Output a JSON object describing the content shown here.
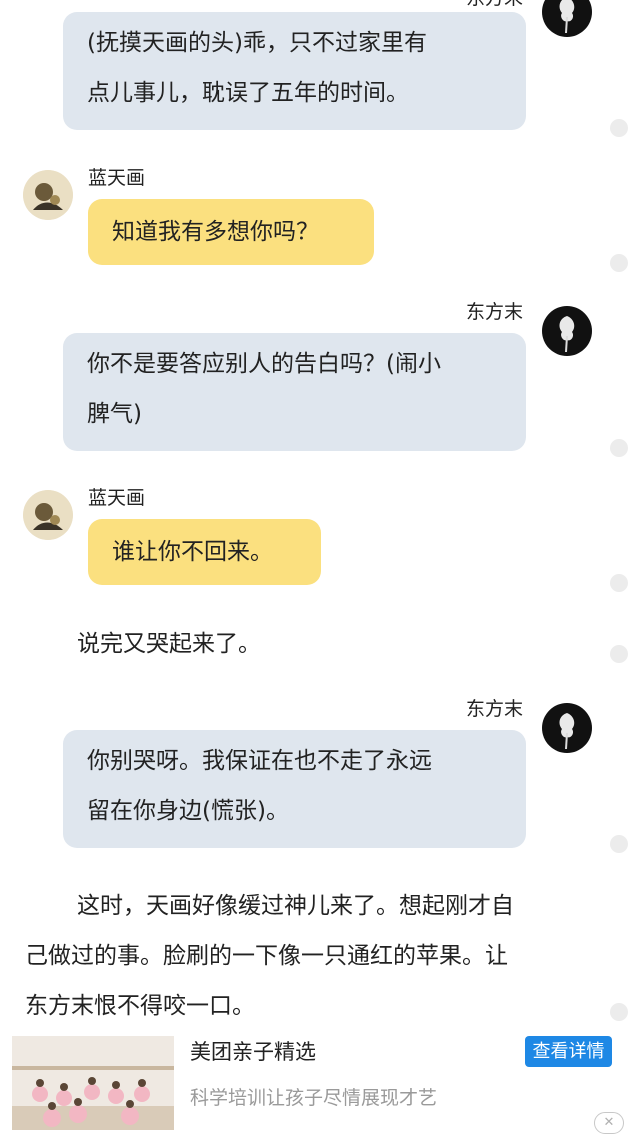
{
  "messages": [
    {
      "side": "right",
      "speaker": "",
      "text_lines": [
        "(抚摸天画的头)乖，只不过家里有",
        "点儿事儿，耽误了五年的时间。"
      ]
    },
    {
      "side": "left",
      "speaker": "蓝天画",
      "text_lines": [
        "知道我有多想你吗？"
      ]
    },
    {
      "side": "right",
      "speaker": "东方末",
      "text_lines": [
        "你不是要答应别人的告白吗？(闹小",
        "脾气)"
      ]
    },
    {
      "side": "left",
      "speaker": "蓝天画",
      "text_lines": [
        "谁让你不回来。"
      ]
    },
    {
      "side": "right",
      "speaker": "东方末",
      "text_lines": [
        "你别哭呀。我保证在也不走了永远",
        "留在你身边(慌张)。"
      ]
    }
  ],
  "narration": {
    "line1": "说完又哭起来了。",
    "para_lines": [
      "这时，天画好像缓过神儿来了。想起刚才自",
      "己做过的事。脸刷的一下像一只通红的苹果。让",
      "东方末恨不得咬一口。"
    ]
  },
  "ad": {
    "title": "美团亲子精选",
    "subtitle": "科学培训让孩子尽情展现才艺",
    "button": "查看详情",
    "close_glyph": "✕"
  },
  "colors": {
    "right_bubble": "#dfe6ee",
    "left_bubble": "#fbe07f",
    "ad_button": "#1e88e5"
  }
}
